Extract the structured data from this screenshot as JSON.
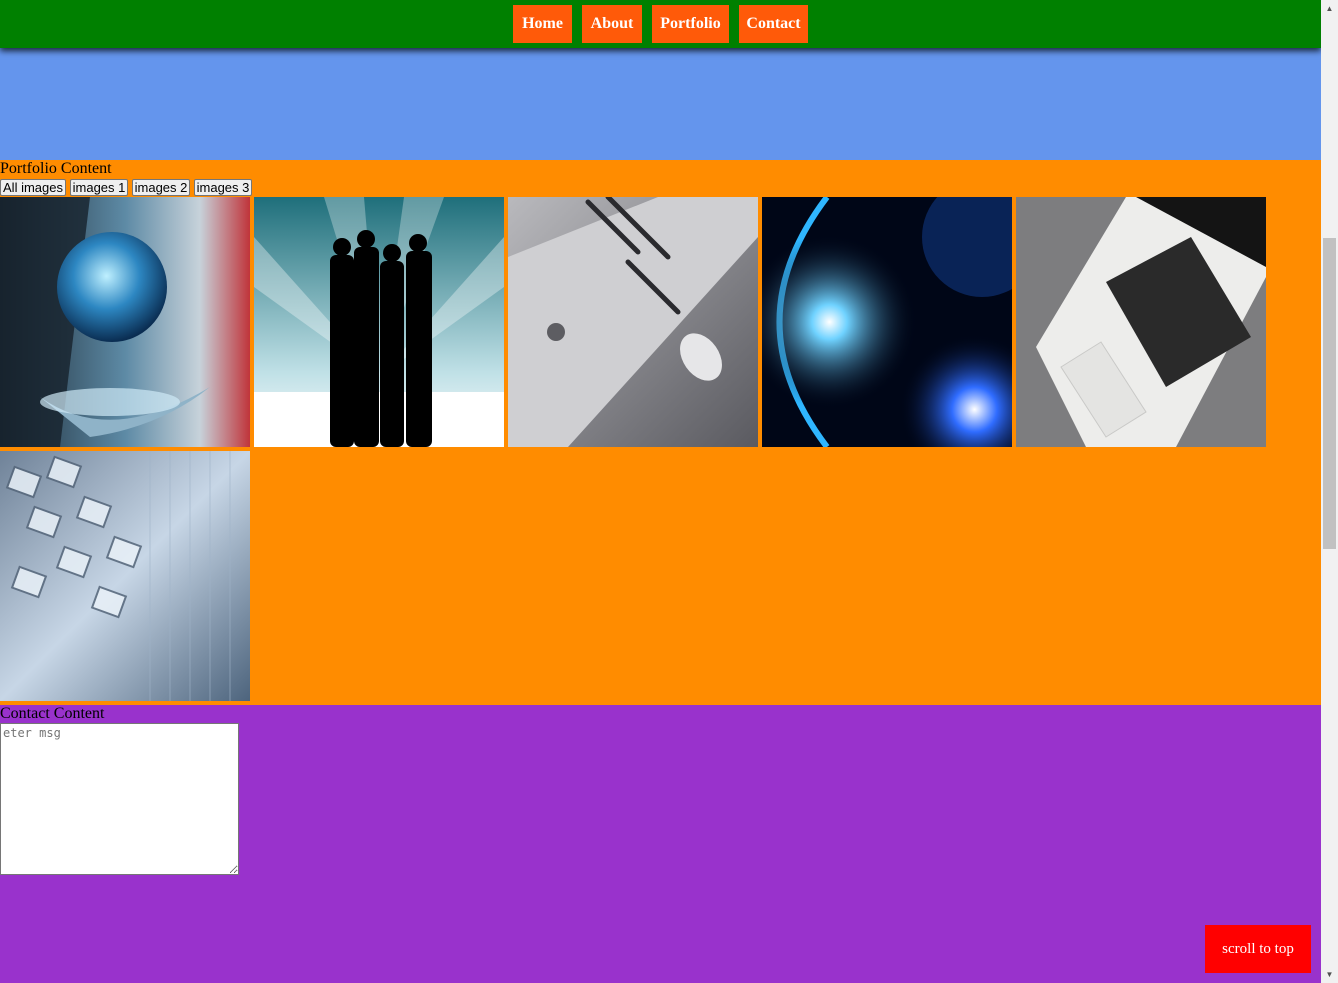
{
  "nav": {
    "items": [
      "Home",
      "About",
      "Portfolio",
      "Contact"
    ],
    "bar_color": "#008000",
    "button_color": "#ff5a09"
  },
  "portfolio": {
    "title": "Portfolio Content",
    "background": "#ff8c00",
    "filters": [
      "All images",
      "images 1",
      "images 2",
      "images 3"
    ],
    "tiles": [
      "globe-in-hand",
      "business-silhouettes",
      "laptop-desk",
      "planet-glow",
      "laptop-keyboard",
      "abstract-cubes"
    ]
  },
  "about": {
    "background": "#6495ed"
  },
  "contact": {
    "title": "Contact Content",
    "background": "#9932cc",
    "message_placeholder": "eter msg"
  },
  "scroll_top": {
    "label": "scroll to top",
    "color": "#ff0000"
  }
}
